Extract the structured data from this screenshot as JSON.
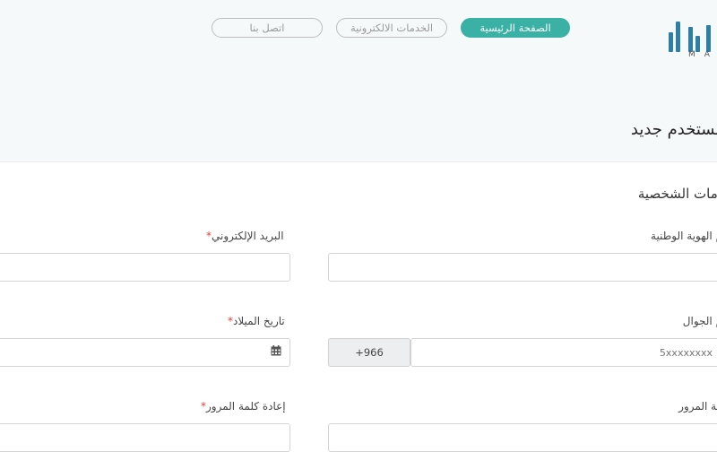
{
  "nav": {
    "home": "الصفحة الرئيسية",
    "eservices": "الخدمات الالكترونية",
    "contact": "اتصل بنا"
  },
  "logo": {
    "latin_text": "MA"
  },
  "page": {
    "title": "مستخدم جديد",
    "section_title": "ومات الشخصية"
  },
  "form": {
    "national_id_label": "م الهوية الوطنية",
    "email_label": "البريد الإلكتروني",
    "mobile_label": "م الجوال",
    "mobile_prefix": "+966",
    "mobile_placeholder": "5xxxxxxxx",
    "birthdate_label": "تاريخ الميلاد",
    "password_label": "مة المرور",
    "confirm_password_label": "إعادة كلمة المرور",
    "required_mark": "*"
  },
  "colors": {
    "accent": "#3ab1a4",
    "required": "#e0403a",
    "logo": "#2e7fa6"
  }
}
